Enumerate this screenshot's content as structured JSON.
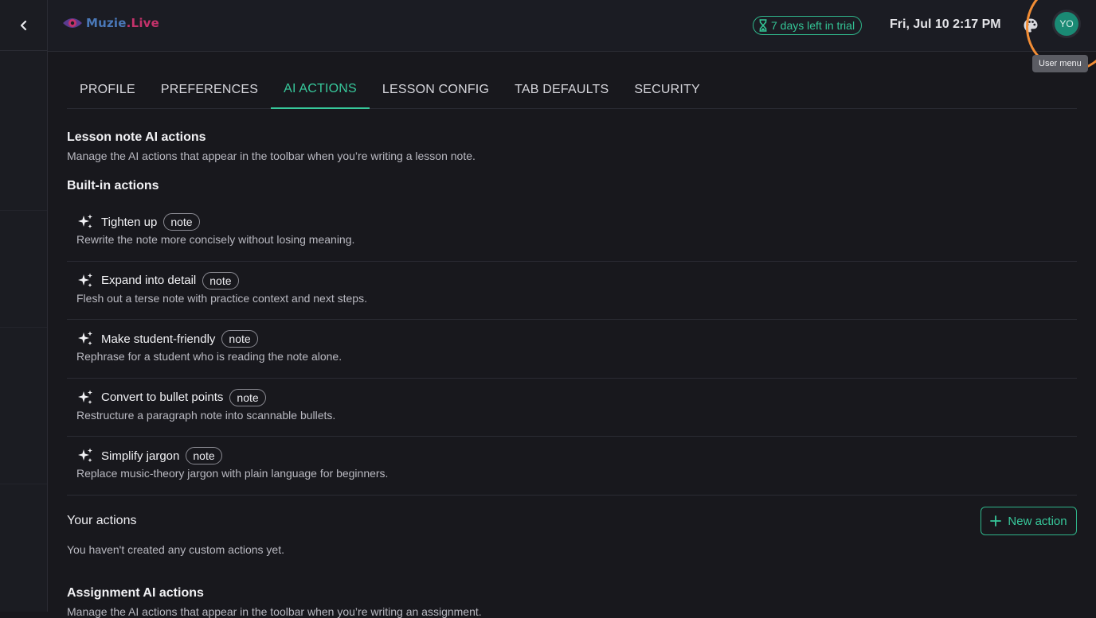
{
  "app": {
    "logo_text": "Muzie",
    "logo_suffix": ".Live"
  },
  "header": {
    "trial": "7 days left in trial",
    "datetime": "Fri, Jul 10 2:17 PM",
    "avatar_initials": "YO",
    "tooltip": "User menu"
  },
  "tabs": [
    {
      "label": "PROFILE"
    },
    {
      "label": "PREFERENCES"
    },
    {
      "label": "AI ACTIONS"
    },
    {
      "label": "LESSON CONFIG"
    },
    {
      "label": "TAB DEFAULTS"
    },
    {
      "label": "SECURITY"
    }
  ],
  "active_tab": "AI ACTIONS",
  "lesson_note": {
    "title": "Lesson note AI actions",
    "description": "Manage the AI actions that appear in the toolbar when you’re writing a lesson note.",
    "builtin_title": "Built-in actions",
    "actions": [
      {
        "name": "Tighten up",
        "tag": "note",
        "description": "Rewrite the note more concisely without losing meaning."
      },
      {
        "name": "Expand into detail",
        "tag": "note",
        "description": "Flesh out a terse note with practice context and next steps."
      },
      {
        "name": "Make student-friendly",
        "tag": "note",
        "description": "Rephrase for a student who is reading the note alone."
      },
      {
        "name": "Convert to bullet points",
        "tag": "note",
        "description": "Restructure a paragraph note into scannable bullets."
      },
      {
        "name": "Simplify jargon",
        "tag": "note",
        "description": "Replace music-theory jargon with plain language for beginners."
      }
    ]
  },
  "your_actions": {
    "title": "Your actions",
    "new_button": "New action",
    "empty_text": "You haven't created any custom actions yet."
  },
  "assignment": {
    "title": "Assignment AI actions",
    "description": "Manage the AI actions that appear in the toolbar when you’re writing an assignment."
  },
  "colors": {
    "accent": "#37c89b",
    "background": "#18181d",
    "highlight": "#f28d35"
  }
}
